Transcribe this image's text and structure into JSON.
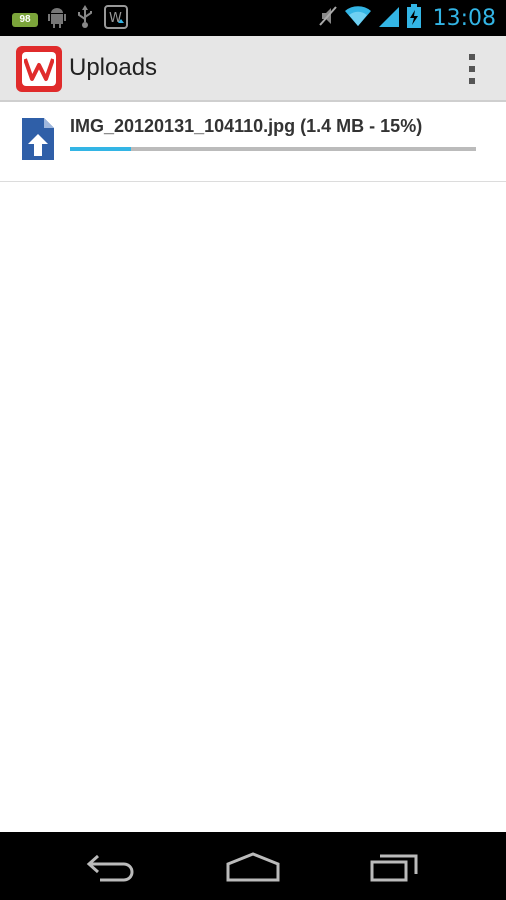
{
  "status_bar": {
    "battery_level": "98",
    "time": "13:08",
    "icons": [
      "battery-icon",
      "android-icon",
      "usb-icon",
      "wordpress-notification-icon",
      "mute-icon",
      "wifi-icon",
      "signal-icon",
      "charging-battery-icon"
    ]
  },
  "action_bar": {
    "title": "Uploads",
    "logo_icon": "app-logo-w",
    "menu_icon": "overflow-menu-icon"
  },
  "uploads": [
    {
      "filename": "IMG_20120131_104110.jpg (1.4 MB -  15%)",
      "progress": 0.15,
      "icon": "upload-file-icon"
    }
  ],
  "colors": {
    "accent": "#33b5e5",
    "logo_red": "#e02b2b",
    "actionbar_bg": "#e6e6e6",
    "file_icon_blue": "#2f5fa8"
  },
  "nav_bar": {
    "icons": [
      "back-icon",
      "home-icon",
      "recent-apps-icon"
    ]
  }
}
